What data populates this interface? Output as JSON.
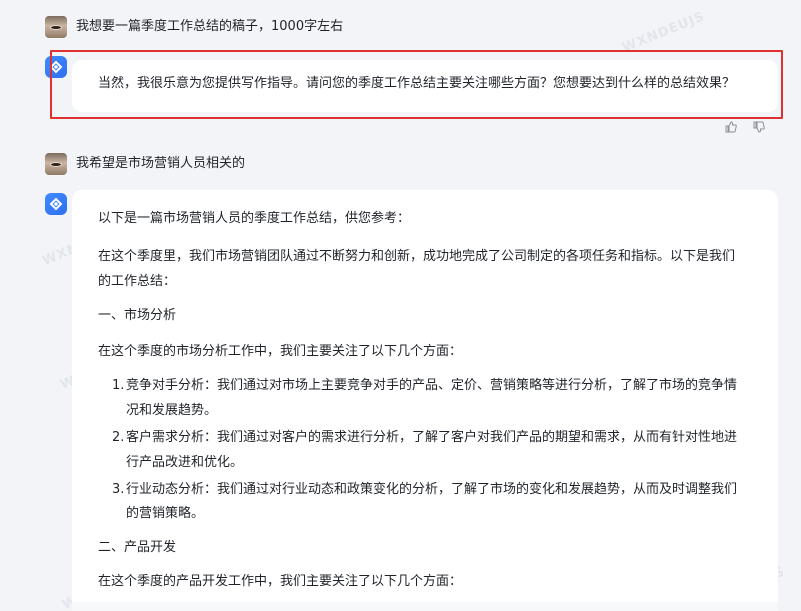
{
  "conversation": {
    "user_msg_1": "我想要一篇季度工作总结的稿子，1000字左右",
    "bot_msg_1": "当然，我很乐意为您提供写作指导。请问您的季度工作总结主要关注哪些方面？您想要达到什么样的总结效果？",
    "user_msg_2": "我希望是市场营销人员相关的",
    "answer": {
      "intro": "以下是一篇市场营销人员的季度工作总结，供您参考：",
      "para1_line1": "在这个季度里，我们市场营销团队通过不断努力和创新，成功地完成了公司制定的各项任务和指标。以下是我们",
      "para1_line2": "的工作总结：",
      "section1_title": "一、市场分析",
      "section1_lead": "在这个季度的市场分析工作中，我们主要关注了以下几个方面：",
      "items": [
        {
          "num": "1.",
          "line1": "竞争对手分析：我们通过对市场上主要竞争对手的产品、定价、营销策略等进行分析，了解了市场的竞争情",
          "line2": "况和发展趋势。"
        },
        {
          "num": "2.",
          "line1": "客户需求分析：我们通过对客户的需求进行分析，了解了客户对我们产品的期望和需求，从而有针对性地进",
          "line2": "行产品改进和优化。"
        },
        {
          "num": "3.",
          "line1": "行业动态分析：我们通过对行业动态和政策变化的分析，了解了市场的变化和发展趋势，从而及时调整我们",
          "line2": "的营销策略。"
        }
      ],
      "section2_title": "二、产品开发",
      "section2_lead": "在这个季度的产品开发工作中，我们主要关注了以下几个方面："
    }
  },
  "icons": {
    "bot_avatar": "bot-logo-icon",
    "thumbs_up": "thumbs-up-icon",
    "thumbs_down": "thumbs-down-icon"
  },
  "colors": {
    "highlight": "#e03131",
    "accent": "#3f8bff"
  },
  "watermark": "WXNDEUJS"
}
